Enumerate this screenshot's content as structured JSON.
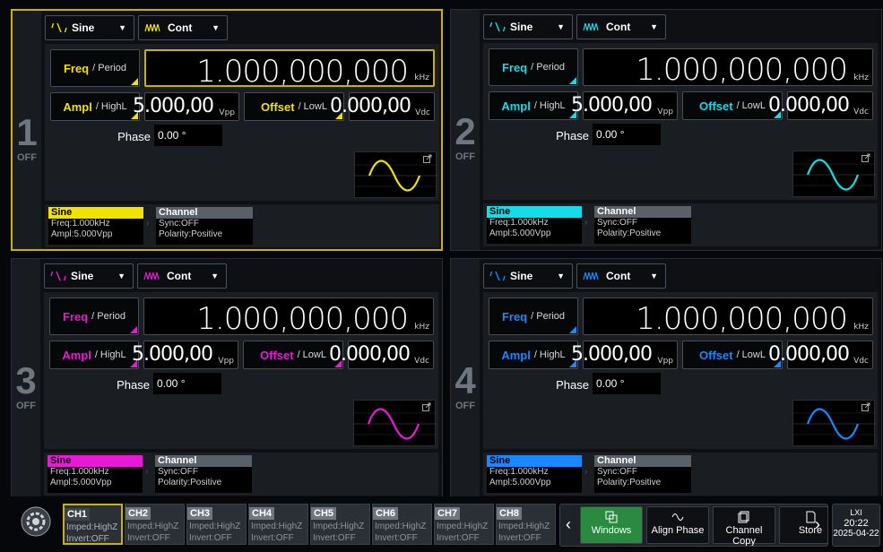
{
  "colors": {
    "ch1": "#f2e200",
    "ch2": "#18dbe8",
    "ch3": "#e81ad8",
    "ch4": "#1a88ff",
    "active_border": "#c9b200",
    "button_green": "#2a8a40"
  },
  "channels": [
    {
      "number": "1",
      "state": "OFF",
      "waveform": "Sine",
      "mode": "Cont",
      "freq_label": "Freq",
      "period_label": "/ Period",
      "freq_value": "1.000,000,000",
      "freq_unit": "kHz",
      "ampl_label": "Ampl",
      "highl_label": "/ HighL",
      "ampl_value": "5.000,00",
      "ampl_unit": "Vpp",
      "offset_label": "Offset",
      "lowl_label": "/ LowL",
      "offset_value": "0.000,00",
      "offset_unit": "Vdc",
      "phase_label": "Phase",
      "phase_value": "0.00 °",
      "summary_title": "Sine",
      "summary_freq": "Freq:1.000kHz",
      "summary_ampl": "Ampl:5.000Vpp",
      "channel_title": "Channel",
      "sync": "Sync:OFF",
      "polarity": "Polarity:Positive"
    },
    {
      "number": "2",
      "state": "OFF",
      "waveform": "Sine",
      "mode": "Cont",
      "freq_label": "Freq",
      "period_label": "/ Period",
      "freq_value": "1.000,000,000",
      "freq_unit": "kHz",
      "ampl_label": "Ampl",
      "highl_label": "/ HighL",
      "ampl_value": "5.000,00",
      "ampl_unit": "Vpp",
      "offset_label": "Offset",
      "lowl_label": "/ LowL",
      "offset_value": "0.000,00",
      "offset_unit": "Vdc",
      "phase_label": "Phase",
      "phase_value": "0.00 °",
      "summary_title": "Sine",
      "summary_freq": "Freq:1.000kHz",
      "summary_ampl": "Ampl:5.000Vpp",
      "channel_title": "Channel",
      "sync": "Sync:OFF",
      "polarity": "Polarity:Positive"
    },
    {
      "number": "3",
      "state": "OFF",
      "waveform": "Sine",
      "mode": "Cont",
      "freq_label": "Freq",
      "period_label": "/ Period",
      "freq_value": "1.000,000,000",
      "freq_unit": "kHz",
      "ampl_label": "Ampl",
      "highl_label": "/ HighL",
      "ampl_value": "5.000,00",
      "ampl_unit": "Vpp",
      "offset_label": "Offset",
      "lowl_label": "/ LowL",
      "offset_value": "0.000,00",
      "offset_unit": "Vdc",
      "phase_label": "Phase",
      "phase_value": "0.00 °",
      "summary_title": "Sine",
      "summary_freq": "Freq:1.000kHz",
      "summary_ampl": "Ampl:5.000Vpp",
      "channel_title": "Channel",
      "sync": "Sync:OFF",
      "polarity": "Polarity:Positive"
    },
    {
      "number": "4",
      "state": "OFF",
      "waveform": "Sine",
      "mode": "Cont",
      "freq_label": "Freq",
      "period_label": "/ Period",
      "freq_value": "1.000,000,000",
      "freq_unit": "kHz",
      "ampl_label": "Ampl",
      "highl_label": "/ HighL",
      "ampl_value": "5.000,00",
      "ampl_unit": "Vpp",
      "offset_label": "Offset",
      "lowl_label": "/ LowL",
      "offset_value": "0.000,00",
      "offset_unit": "Vdc",
      "phase_label": "Phase",
      "phase_value": "0.00 °",
      "summary_title": "Sine",
      "summary_freq": "Freq:1.000kHz",
      "summary_ampl": "Ampl:5.000Vpp",
      "channel_title": "Channel",
      "sync": "Sync:OFF",
      "polarity": "Polarity:Positive"
    }
  ],
  "ch_tabs": [
    {
      "name": "CH1",
      "imped": "Imped:HighZ",
      "invert": "Invert:OFF"
    },
    {
      "name": "CH2",
      "imped": "Imped:HighZ",
      "invert": "Invert:OFF"
    },
    {
      "name": "CH3",
      "imped": "Imped:HighZ",
      "invert": "Invert:OFF"
    },
    {
      "name": "CH4",
      "imped": "Imped:HighZ",
      "invert": "Invert:OFF"
    },
    {
      "name": "CH5",
      "imped": "Imped:HighZ",
      "invert": "Invert:OFF"
    },
    {
      "name": "CH6",
      "imped": "Imped:HighZ",
      "invert": "Invert:OFF"
    },
    {
      "name": "CH7",
      "imped": "Imped:HighZ",
      "invert": "Invert:OFF"
    },
    {
      "name": "CH8",
      "imped": "Imped:HighZ",
      "invert": "Invert:OFF"
    }
  ],
  "toolbar": {
    "windows": "Windows",
    "align_phase": "Align Phase",
    "channel_copy": "Channel Copy",
    "store": "Store"
  },
  "status": {
    "indicator": "LXI",
    "time": "20:22",
    "date": "2025-04-22"
  }
}
